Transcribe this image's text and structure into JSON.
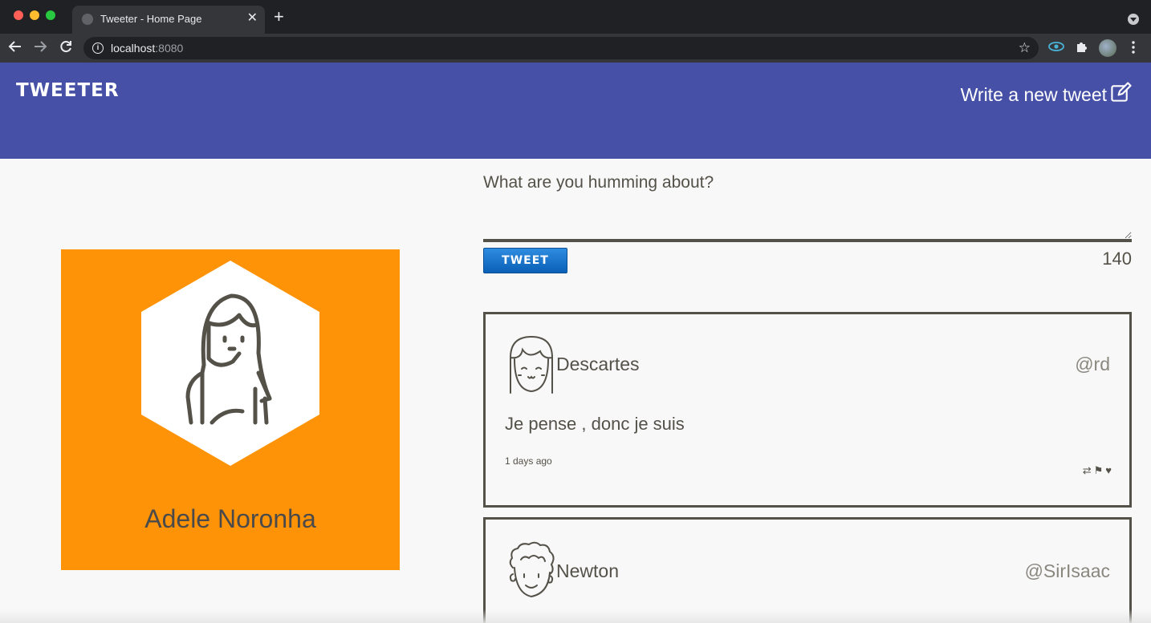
{
  "browser": {
    "tab_title": "Tweeter - Home Page",
    "close_glyph": "✕",
    "new_tab_glyph": "+",
    "url_host": "localhost",
    "url_port": ":8080",
    "icons": [
      "back-icon",
      "forward-icon",
      "reload-icon",
      "info-icon",
      "star-icon",
      "eye-extension-icon",
      "puzzle-extension-icon",
      "profile-icon",
      "kebab-menu-icon"
    ]
  },
  "header": {
    "logo": "TWEETER",
    "compose_label": "Write a new tweet",
    "compose_icon": "edit-icon",
    "color": "#4650a6"
  },
  "profile": {
    "name": "Adele Noronha",
    "background_color": "#ff9307",
    "avatar_icon": "girl-avatar-icon"
  },
  "compose": {
    "placeholder": "What are you humming about?",
    "button_label": "TWEET",
    "counter": "140"
  },
  "tweets": [
    {
      "name": "Descartes",
      "handle": "@rd",
      "text": "Je pense , donc je suis",
      "time": "1 days ago",
      "avatar_icon": "girl-bangs-avatar-icon",
      "actions": {
        "retweet": "⇄",
        "flag": "⚑",
        "like": "♥"
      }
    },
    {
      "name": "Newton",
      "handle": "@SirIsaac",
      "avatar_icon": "curly-hair-avatar-icon"
    }
  ]
}
